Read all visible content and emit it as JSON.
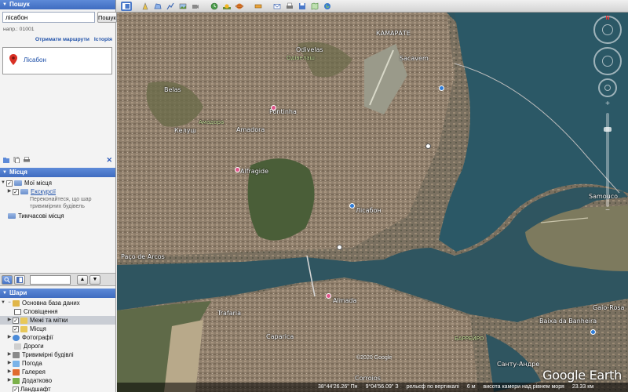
{
  "search": {
    "header": "Пошук",
    "query": "лісабон",
    "button": "Пошук",
    "example": "напр.: 01001",
    "routes_link": "Отримати маршрути",
    "history_link": "Історія",
    "result": "Лісабон"
  },
  "places": {
    "header": "Місця",
    "my_places": "Мої місця",
    "tours": "Екскурсії",
    "tours_hint_1": "Переконайтеся, що шар",
    "tours_hint_2": "тривимірних будівель",
    "temp_places": "Тимчасові місця"
  },
  "layers": {
    "header": "Шари",
    "items": [
      {
        "label": "Основна база даних",
        "color": "#e0b64a"
      },
      {
        "label": "Сповіщення",
        "color": "#ffffff"
      },
      {
        "label": "Межі та мітки",
        "color": "#e8c85a"
      },
      {
        "label": "Місця",
        "color": "#e8c85a"
      },
      {
        "label": "Фотографії",
        "color": "#4a8ad8"
      },
      {
        "label": "Дороги",
        "color": "#cfcfcf"
      },
      {
        "label": "Тривимірні будівлі",
        "color": "#8a8a8a"
      },
      {
        "label": "Погода",
        "color": "#7ab3e8"
      },
      {
        "label": "Галерея",
        "color": "#e06b2e"
      },
      {
        "label": "Додатково",
        "color": "#7bb04a"
      },
      {
        "label": "Ландшафт",
        "color": "#ffffff"
      }
    ]
  },
  "map": {
    "places": {
      "kamarate": "КАМАРАТЕ",
      "odivelas": "Odivelas",
      "odivelas_cyr": "Одівелаш",
      "sacavem": "Sacavem",
      "belas": "Belas",
      "pontinha": "Pontinha",
      "amadora_cyr": "Амадора",
      "amadora": "Amadora",
      "kelush": "Келуш",
      "alfragide": "Alfragide",
      "samouco": "Samouco",
      "lisbon": "Лісабон",
      "paco": "Paço de Arcos",
      "almada": "Almada",
      "trafaria": "Trafaria",
      "caparica": "Caparica",
      "barreiro": "БАРРЕЙРО",
      "baixa": "Baixa da Banheira",
      "gaio": "Gaio-Rosa",
      "corroios": "Corroios",
      "santo": "Санту-Андре"
    },
    "copyright": "©2020 Google",
    "logo": "Google Earth",
    "compass_n": "N"
  },
  "status": {
    "lat": "38°44'26.26\" Пн",
    "lon": "9°04'56.09\" З",
    "elev": "рельєф по вертикалі",
    "elev_val": "6 м",
    "eye": "висота камери над рівнем моря",
    "eye_val": "23.33 км"
  }
}
